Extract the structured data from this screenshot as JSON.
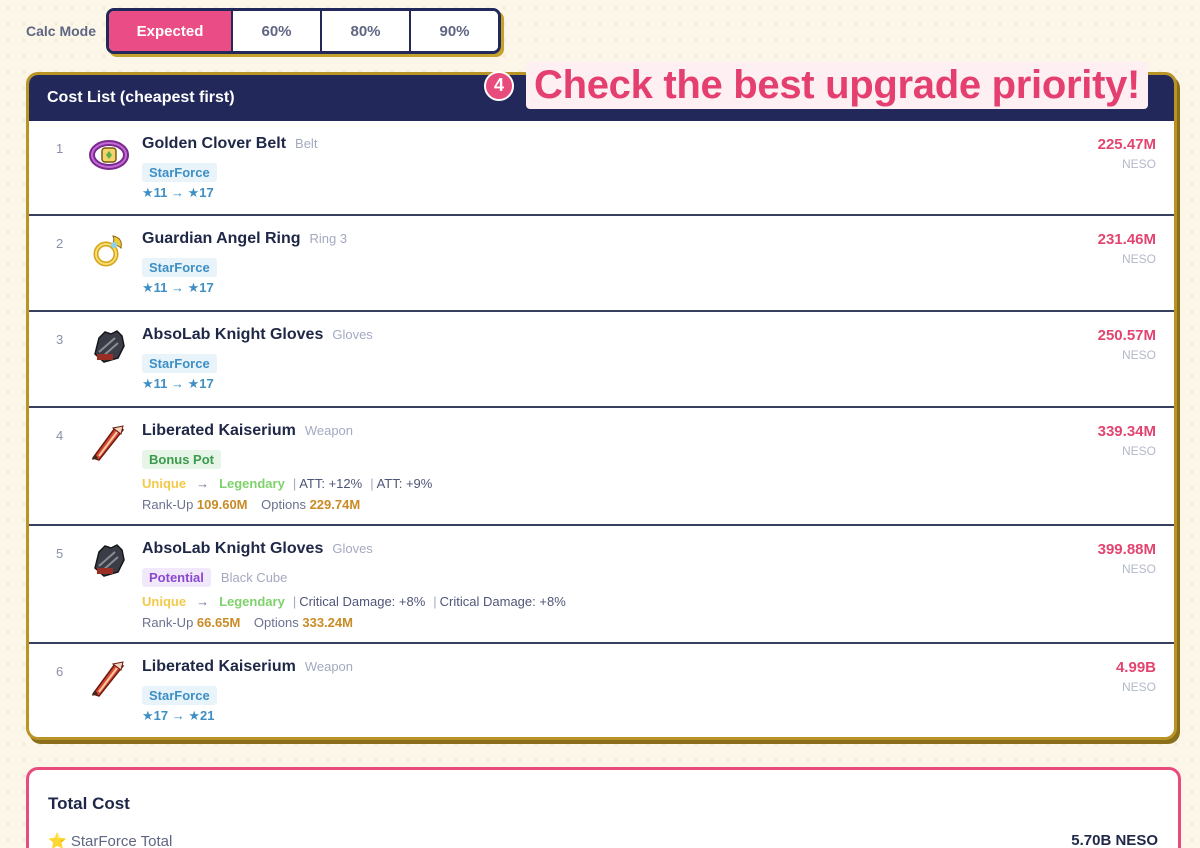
{
  "calc_mode": {
    "label": "Calc Mode",
    "options": [
      "Expected",
      "60%",
      "80%",
      "90%"
    ],
    "selected": "Expected"
  },
  "callout": {
    "number": "4",
    "text": "Check the best upgrade priority!"
  },
  "cost_list": {
    "title": "Cost List (cheapest first)",
    "unit": "NESO",
    "items": [
      {
        "rank": "1",
        "name": "Golden Clover Belt",
        "slot": "Belt",
        "tag": "StarForce",
        "stars": "★11 → ★17",
        "price": "225.47M",
        "icon": "belt-icon"
      },
      {
        "rank": "2",
        "name": "Guardian Angel Ring",
        "slot": "Ring 3",
        "tag": "StarForce",
        "stars": "★11 → ★17",
        "price": "231.46M",
        "icon": "ring-icon"
      },
      {
        "rank": "3",
        "name": "AbsoLab Knight Gloves",
        "slot": "Gloves",
        "tag": "StarForce",
        "stars": "★11 → ★17",
        "price": "250.57M",
        "icon": "gloves-icon"
      },
      {
        "rank": "4",
        "name": "Liberated Kaiserium",
        "slot": "Weapon",
        "tag": "Bonus Pot",
        "tier_from": "Unique",
        "tier_to": "Legendary",
        "stats": [
          "ATT: +12%",
          "ATT: +9%"
        ],
        "rankup_label": "Rank-Up",
        "rankup": "109.60M",
        "options_label": "Options",
        "options": "229.74M",
        "price": "339.34M",
        "icon": "sword-icon"
      },
      {
        "rank": "5",
        "name": "AbsoLab Knight Gloves",
        "slot": "Gloves",
        "tag": "Potential",
        "tag_sub": "Black Cube",
        "tier_from": "Unique",
        "tier_to": "Legendary",
        "stats": [
          "Critical Damage: +8%",
          "Critical Damage: +8%"
        ],
        "rankup_label": "Rank-Up",
        "rankup": "66.65M",
        "options_label": "Options",
        "options": "333.24M",
        "price": "399.88M",
        "icon": "gloves-icon"
      },
      {
        "rank": "6",
        "name": "Liberated Kaiserium",
        "slot": "Weapon",
        "tag": "StarForce",
        "stars": "★17 → ★21",
        "price": "4.99B",
        "icon": "sword-icon"
      }
    ]
  },
  "total": {
    "title": "Total Cost",
    "starforce_label": "StarForce Total",
    "starforce_value": "5.70B NESO"
  },
  "colors": {
    "accent_pink": "#ea4d85",
    "navy": "#22295a",
    "gold_border": "#b89326",
    "starforce_blue": "#3d8fc4"
  }
}
